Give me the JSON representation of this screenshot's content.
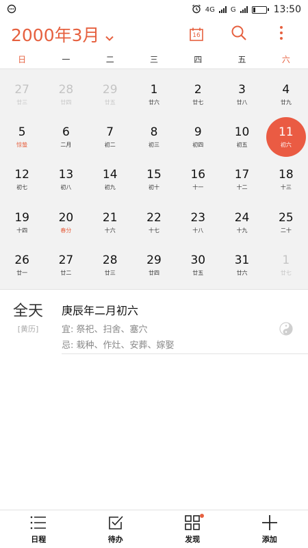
{
  "status_bar": {
    "time": "13:50",
    "network_1": "4G",
    "network_2": "G",
    "battery_level": 0.2,
    "icons": [
      "notification-dot-icon",
      "alarm-icon",
      "signal-icon",
      "battery-icon"
    ]
  },
  "header": {
    "month_title": "2000年3月",
    "today_badge": "16",
    "actions": [
      "today-calendar-icon",
      "search-icon",
      "more-vert-icon"
    ]
  },
  "weekdays": [
    "日",
    "一",
    "二",
    "三",
    "四",
    "五",
    "六"
  ],
  "days": [
    {
      "num": "27",
      "lunar": "廿三",
      "state": "other"
    },
    {
      "num": "28",
      "lunar": "廿四",
      "state": "other"
    },
    {
      "num": "29",
      "lunar": "廿五",
      "state": "other"
    },
    {
      "num": "1",
      "lunar": "廿六",
      "state": "normal"
    },
    {
      "num": "2",
      "lunar": "廿七",
      "state": "normal"
    },
    {
      "num": "3",
      "lunar": "廿八",
      "state": "normal"
    },
    {
      "num": "4",
      "lunar": "廿九",
      "state": "normal"
    },
    {
      "num": "5",
      "lunar": "惊蛰",
      "state": "term"
    },
    {
      "num": "6",
      "lunar": "二月",
      "state": "normal"
    },
    {
      "num": "7",
      "lunar": "初二",
      "state": "normal"
    },
    {
      "num": "8",
      "lunar": "初三",
      "state": "normal"
    },
    {
      "num": "9",
      "lunar": "初四",
      "state": "normal"
    },
    {
      "num": "10",
      "lunar": "初五",
      "state": "normal"
    },
    {
      "num": "11",
      "lunar": "初六",
      "state": "selected"
    },
    {
      "num": "12",
      "lunar": "初七",
      "state": "normal"
    },
    {
      "num": "13",
      "lunar": "初八",
      "state": "normal"
    },
    {
      "num": "14",
      "lunar": "初九",
      "state": "normal"
    },
    {
      "num": "15",
      "lunar": "初十",
      "state": "normal"
    },
    {
      "num": "16",
      "lunar": "十一",
      "state": "normal"
    },
    {
      "num": "17",
      "lunar": "十二",
      "state": "normal"
    },
    {
      "num": "18",
      "lunar": "十三",
      "state": "normal"
    },
    {
      "num": "19",
      "lunar": "十四",
      "state": "normal"
    },
    {
      "num": "20",
      "lunar": "春分",
      "state": "term"
    },
    {
      "num": "21",
      "lunar": "十六",
      "state": "normal"
    },
    {
      "num": "22",
      "lunar": "十七",
      "state": "normal"
    },
    {
      "num": "23",
      "lunar": "十八",
      "state": "normal"
    },
    {
      "num": "24",
      "lunar": "十九",
      "state": "normal"
    },
    {
      "num": "25",
      "lunar": "二十",
      "state": "normal"
    },
    {
      "num": "26",
      "lunar": "廿一",
      "state": "normal"
    },
    {
      "num": "27",
      "lunar": "廿二",
      "state": "normal"
    },
    {
      "num": "28",
      "lunar": "廿三",
      "state": "normal"
    },
    {
      "num": "29",
      "lunar": "廿四",
      "state": "normal"
    },
    {
      "num": "30",
      "lunar": "廿五",
      "state": "normal"
    },
    {
      "num": "31",
      "lunar": "廿六",
      "state": "normal"
    },
    {
      "num": "1",
      "lunar": "廿七",
      "state": "other"
    }
  ],
  "detail": {
    "allday_label": "全天",
    "allday_sub": "[黄历]",
    "lunar_date": "庚辰年二月初六",
    "suitable": "宜: 祭祀、扫舍、塞穴",
    "avoid": "忌: 栽种、作灶、安葬、嫁娶",
    "icon": "yin-yang-icon"
  },
  "bottom_nav": [
    {
      "label": "日程",
      "icon": "list-icon",
      "has_dot": false
    },
    {
      "label": "待办",
      "icon": "checkbox-icon",
      "has_dot": false
    },
    {
      "label": "发现",
      "icon": "grid-icon",
      "has_dot": true
    },
    {
      "label": "添加",
      "icon": "plus-icon",
      "has_dot": false
    }
  ],
  "colors": {
    "accent": "#e6603f",
    "selected_circle": "#ea5b43",
    "grid_background": "#f2f2f2"
  }
}
